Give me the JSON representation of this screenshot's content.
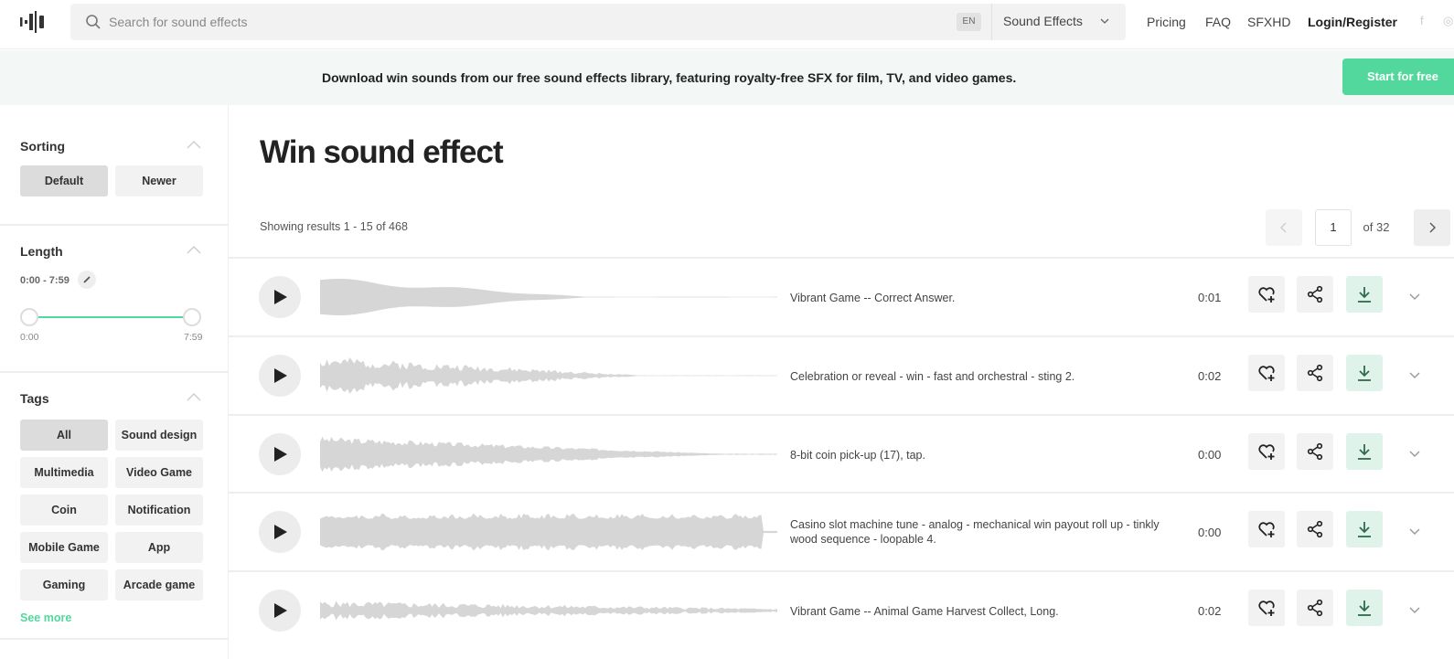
{
  "header": {
    "logo_icon": "waveform-logo-icon",
    "search_placeholder": "Search for sound effects",
    "language": "EN",
    "category": "Sound Effects",
    "nav": [
      "Pricing",
      "FAQ",
      "SFXHD",
      "Login/Register"
    ],
    "social": [
      "f",
      "◎"
    ]
  },
  "banner": {
    "message": "Download win sounds from our free sound effects library, featuring royalty-free SFX for film, TV, and video games.",
    "cta": "Start for free",
    "accent": "#52d79c"
  },
  "sidebar": {
    "sorting": {
      "title": "Sorting",
      "options": [
        "Default",
        "Newer"
      ],
      "active": "Default"
    },
    "length": {
      "title": "Length",
      "range": "0:00 - 7:59",
      "min": "0:00",
      "max": "7:59",
      "selected_fraction": [
        0,
        1
      ]
    },
    "tags": {
      "title": "Tags",
      "items": [
        "All",
        "Sound design",
        "Multimedia",
        "Video Game",
        "Coin",
        "Notification",
        "Mobile Game",
        "App",
        "Gaming",
        "Arcade game"
      ],
      "active": "All",
      "see_more": "See more"
    }
  },
  "main": {
    "title": "Win sound effect",
    "results": "Showing results 1 - 15 of 468",
    "pagination": {
      "current": "1",
      "of": "of 32"
    },
    "rows": [
      {
        "title": "Vibrant Game -- Correct Answer.",
        "duration": "0:01"
      },
      {
        "title": "Celebration or reveal - win - fast and orchestral - sting 2.",
        "duration": "0:02"
      },
      {
        "title": "8-bit coin pick-up (17), tap.",
        "duration": "0:00"
      },
      {
        "title": "Casino slot machine tune - analog - mechanical win payout roll up - tinkly wood sequence - loopable 4.",
        "duration": "0:00"
      },
      {
        "title": "Vibrant Game -- Animal Game Harvest Collect, Long.",
        "duration": "0:02"
      }
    ]
  }
}
